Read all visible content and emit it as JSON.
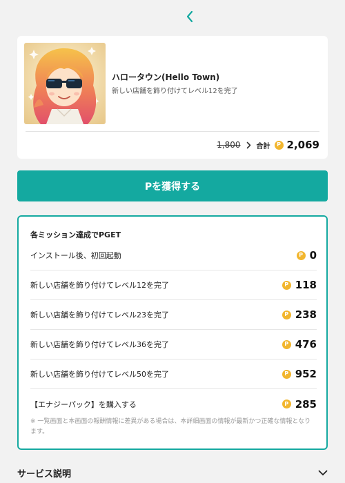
{
  "colors": {
    "accent": "#14a9a0",
    "coin": "#f2b62e",
    "background": "#f2f2f2"
  },
  "nav": {
    "back_icon": "chevron-left-icon"
  },
  "offer": {
    "app_name": "ハロータウン(Hello Town)",
    "description": "新しい店舗を飾り付けてレベル12を完了",
    "old_points": "1,800",
    "total_label": "合計",
    "coin_symbol": "P",
    "total_points": "2,069"
  },
  "cta": {
    "label": "Pを獲得する"
  },
  "missions": {
    "heading": "各ミッション達成でPGET",
    "items": [
      {
        "label": "インストール後、初回起動",
        "points": "0"
      },
      {
        "label": "新しい店舗を飾り付けてレベル12を完了",
        "points": "118"
      },
      {
        "label": "新しい店舗を飾り付けてレベル23を完了",
        "points": "238"
      },
      {
        "label": "新しい店舗を飾り付けてレベル36を完了",
        "points": "476"
      },
      {
        "label": "新しい店舗を飾り付けてレベル50を完了",
        "points": "952"
      },
      {
        "label": "【エナジーパック】を購入する",
        "points": "285"
      }
    ],
    "note": "※ 一覧画面と本画面の報酬情報に差異がある場合は、本詳細画面の情報が最新かつ正確な情報となります。"
  },
  "service": {
    "title": "サービス説明",
    "toggle_icon": "chevron-down-icon"
  }
}
